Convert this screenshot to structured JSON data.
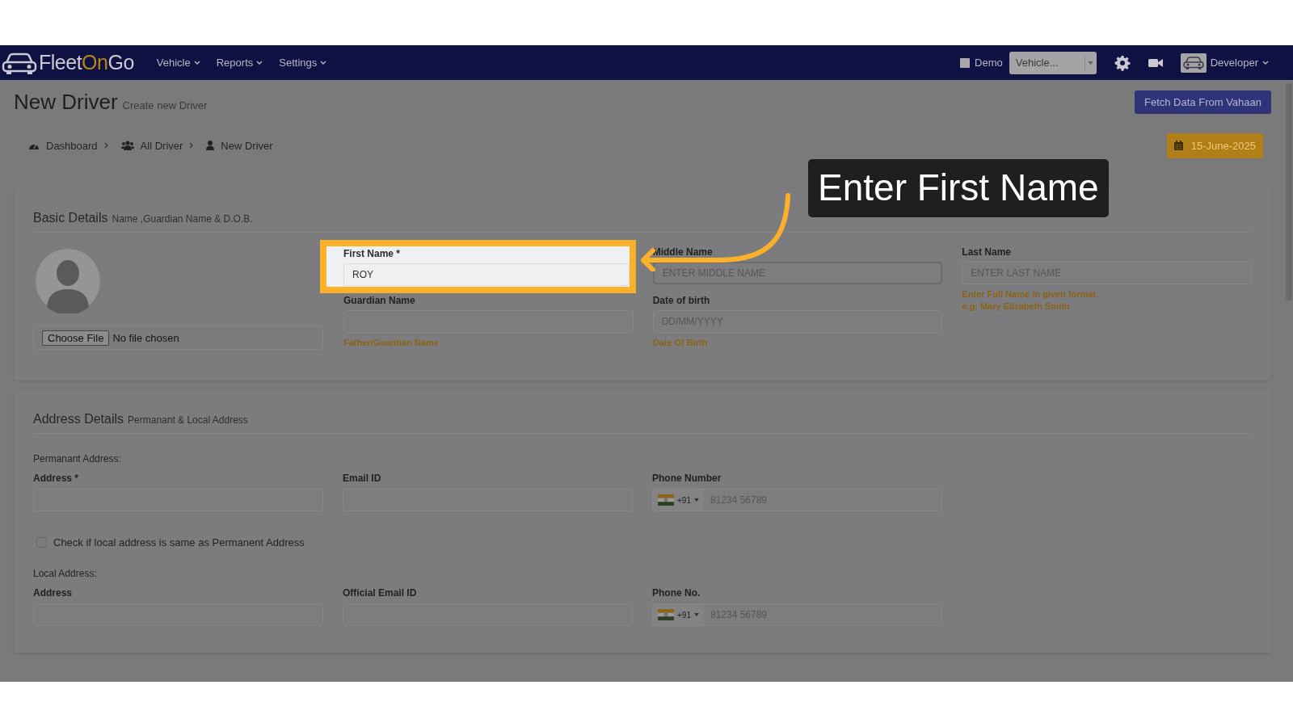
{
  "navbar": {
    "logo_parts": [
      {
        "text": "Fleet",
        "accent": false
      },
      {
        "text": "On",
        "accent": true
      },
      {
        "text": "Go",
        "accent": false
      }
    ],
    "menus": [
      {
        "label": "Vehicle"
      },
      {
        "label": "Reports"
      },
      {
        "label": "Settings"
      }
    ],
    "demo": {
      "label": "Demo",
      "checked": false
    },
    "vehicle_select": {
      "value": "Vehicle..."
    },
    "user": "Developer"
  },
  "header": {
    "title": "New Driver",
    "subtitle": "Create new Driver",
    "fetch_button": "Fetch Data From Vahaan"
  },
  "breadcrumb": [
    {
      "label": "Dashboard"
    },
    {
      "label": "All Driver"
    },
    {
      "label": "New Driver"
    }
  ],
  "date_badge": "15-June-2025",
  "basic_details": {
    "title": "Basic Details",
    "subtitle": "Name ,Guardian Name & D.O.B.",
    "file_button": "Choose File",
    "file_status": "No file chosen",
    "fields": [
      {
        "label": "First Name *",
        "value": "ROY",
        "highlighted": true,
        "focused": false
      },
      {
        "label": "Middle Name",
        "placeholder": "ENTER MIDDLE NAME",
        "highlighted": false,
        "focused": true
      },
      {
        "label": "Last Name",
        "placeholder": "ENTER LAST NAME",
        "hint": "Enter Full Name in given format,\ne.g: Mary Elizabeth Smith",
        "highlighted": false,
        "focused": false
      },
      {
        "label": "Guardian Name",
        "hint": "Father/Guardian Name",
        "highlighted": false,
        "focused": false
      },
      {
        "label": "Date of birth",
        "placeholder": "DD/MM/YYYY",
        "hint": "Date Of Birth",
        "highlighted": false,
        "focused": false
      }
    ]
  },
  "address_details": {
    "title": "Address Details",
    "subtitle": "Permanant & Local Address",
    "permanent_label": "Permanant Address:",
    "permanent_fields": [
      {
        "kind": "text",
        "label": "Address *"
      },
      {
        "kind": "text",
        "label": "Email ID"
      },
      {
        "kind": "phone",
        "label": "Phone Number",
        "code": "+91",
        "placeholder": "81234 56789"
      }
    ],
    "same_address": {
      "label": "Check if local address is same as Permanent Address",
      "checked": false
    },
    "local_label": "Local Address:",
    "local_fields": [
      {
        "kind": "text",
        "label": "Address"
      },
      {
        "kind": "text",
        "label": "Official Email ID"
      },
      {
        "kind": "phone",
        "label": "Phone No.",
        "code": "+91",
        "placeholder": "81234 56789"
      }
    ]
  },
  "callout": "Enter First Name"
}
